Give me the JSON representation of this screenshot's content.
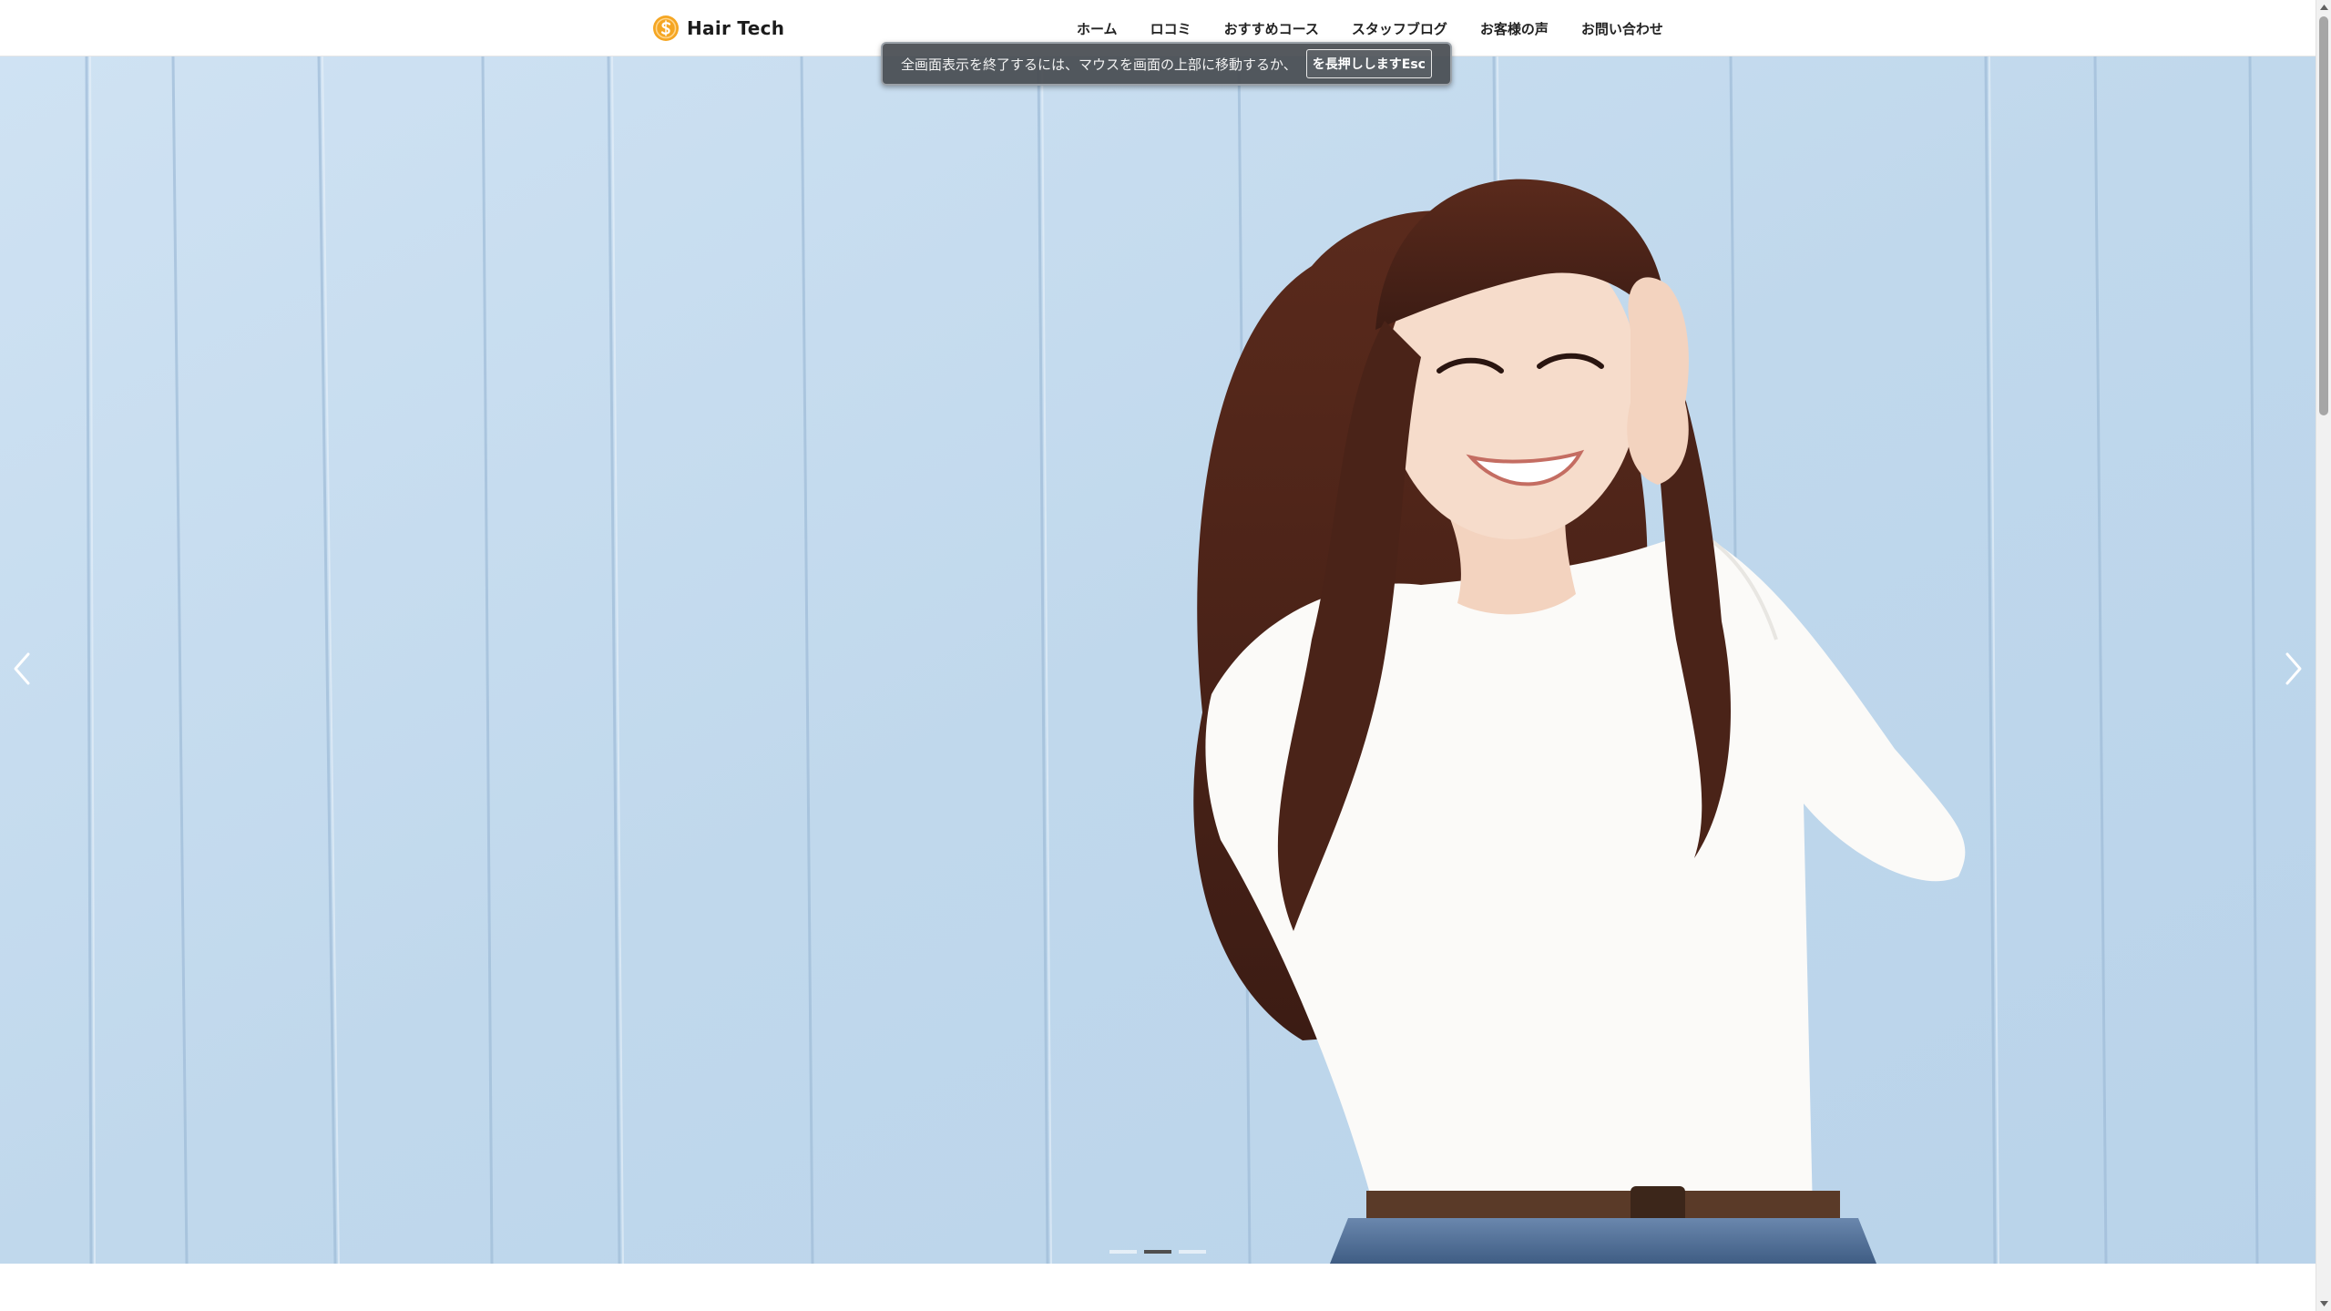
{
  "header": {
    "logo_text": "Hair Tech",
    "nav": [
      {
        "label": "ホーム"
      },
      {
        "label": "ロコミ"
      },
      {
        "label": "おすすめコース"
      },
      {
        "label": "スタッフブログ"
      },
      {
        "label": "お客様の声"
      },
      {
        "label": "お問い合わせ"
      }
    ]
  },
  "fullscreen_notice": {
    "text": "全画面表示を終了するには、マウスを画面の上部に移動するか、",
    "key_text": "を長押ししますEsc"
  },
  "slider": {
    "active_index": 1,
    "slide_count": 3
  },
  "colors": {
    "accent": "#f5a623",
    "sky": "#c3dbee",
    "header_bg": "#ffffff"
  },
  "icons": {
    "logo": "coin-s-logo-icon",
    "prev": "chevron-left-icon",
    "next": "chevron-right-icon",
    "scroll_up": "triangle-up-icon",
    "scroll_down": "triangle-down-icon"
  }
}
